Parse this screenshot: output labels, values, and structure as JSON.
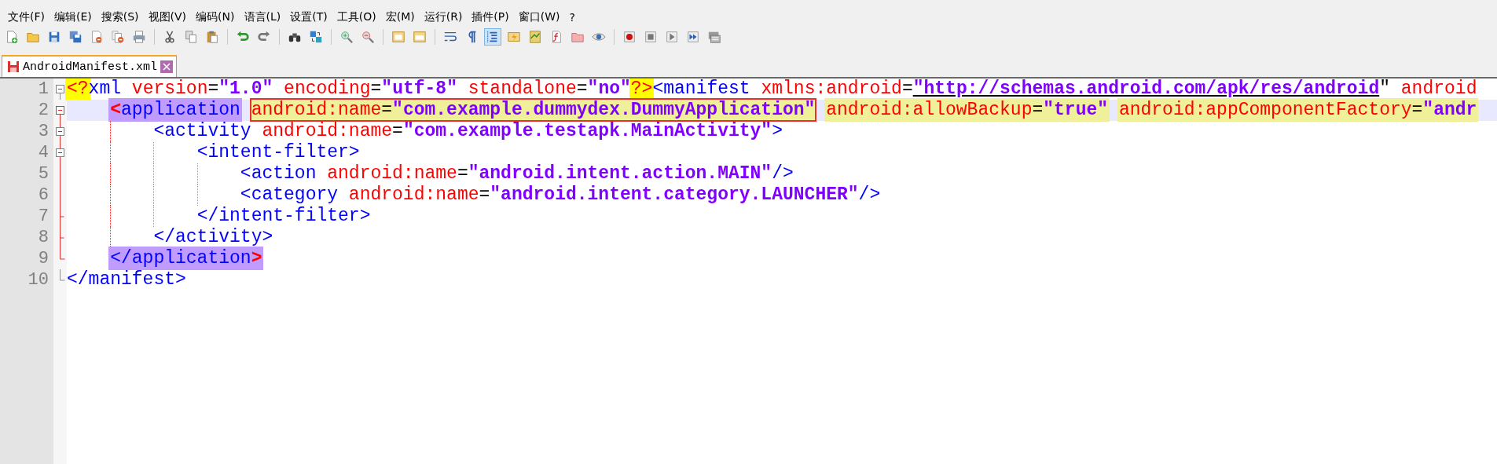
{
  "menu": [
    {
      "label": "文件(F)"
    },
    {
      "label": "编辑(E)"
    },
    {
      "label": "搜索(S)"
    },
    {
      "label": "视图(V)"
    },
    {
      "label": "编码(N)"
    },
    {
      "label": "语言(L)"
    },
    {
      "label": "设置(T)"
    },
    {
      "label": "工具(O)"
    },
    {
      "label": "宏(M)"
    },
    {
      "label": "运行(R)"
    },
    {
      "label": "插件(P)"
    },
    {
      "label": "窗口(W)"
    },
    {
      "label": "?"
    }
  ],
  "toolbar": [
    {
      "kind": "button",
      "pressed": false
    },
    {
      "kind": "button",
      "pressed": false
    },
    {
      "kind": "button",
      "pressed": false
    },
    {
      "kind": "button",
      "pressed": false
    },
    {
      "kind": "button",
      "pressed": false
    },
    {
      "kind": "button",
      "pressed": false
    },
    {
      "kind": "button",
      "pressed": false
    },
    {
      "kind": "separator"
    },
    {
      "kind": "button",
      "pressed": false
    },
    {
      "kind": "button",
      "pressed": false
    },
    {
      "kind": "button",
      "pressed": false
    },
    {
      "kind": "separator"
    },
    {
      "kind": "button",
      "pressed": false
    },
    {
      "kind": "button",
      "pressed": false
    },
    {
      "kind": "separator"
    },
    {
      "kind": "button",
      "pressed": false
    },
    {
      "kind": "button",
      "pressed": false
    },
    {
      "kind": "separator"
    },
    {
      "kind": "button",
      "pressed": false
    },
    {
      "kind": "button",
      "pressed": false
    },
    {
      "kind": "separator"
    },
    {
      "kind": "button",
      "pressed": false
    },
    {
      "kind": "button",
      "pressed": false
    },
    {
      "kind": "separator"
    },
    {
      "kind": "button",
      "pressed": false
    },
    {
      "kind": "button",
      "pressed": false
    },
    {
      "kind": "button",
      "pressed": true
    },
    {
      "kind": "button",
      "pressed": false
    },
    {
      "kind": "button",
      "pressed": false
    },
    {
      "kind": "button",
      "pressed": false
    },
    {
      "kind": "button",
      "pressed": false
    },
    {
      "kind": "button",
      "pressed": false
    },
    {
      "kind": "separator"
    },
    {
      "kind": "button",
      "pressed": false
    },
    {
      "kind": "button",
      "pressed": false
    },
    {
      "kind": "button",
      "pressed": false
    },
    {
      "kind": "button",
      "pressed": false
    },
    {
      "kind": "button",
      "pressed": false
    }
  ],
  "tabs": [
    {
      "label": "AndroidManifest.xml",
      "selected": true
    }
  ],
  "editor": {
    "lines": [
      {
        "number": "1",
        "kind": "fold-start",
        "current": false,
        "fold_active": false,
        "tokens": [
          {
            "kind": "pi",
            "boxed": false,
            "tokens": [
              {
                "kind": "attr",
                "text": "<?"
              }
            ]
          },
          {
            "kind": "tag",
            "text": "xml "
          },
          {
            "kind": "attr",
            "text": "version"
          },
          {
            "kind": "eq",
            "text": "="
          },
          {
            "kind": "value",
            "text": "\"1.0\" "
          },
          {
            "kind": "attr",
            "text": "encoding"
          },
          {
            "kind": "eq",
            "text": "="
          },
          {
            "kind": "value",
            "text": "\"utf-8\" "
          },
          {
            "kind": "attr",
            "text": "standalone"
          },
          {
            "kind": "eq",
            "text": "="
          },
          {
            "kind": "value",
            "text": "\"no\""
          },
          {
            "kind": "pi",
            "boxed": false,
            "tokens": [
              {
                "kind": "attr",
                "text": "?>"
              }
            ]
          },
          {
            "kind": "tag",
            "text": "<manifest "
          },
          {
            "kind": "attr",
            "text": "xmlns:android"
          },
          {
            "kind": "eq",
            "text": "="
          },
          {
            "kind": "url",
            "text": "\"http://schemas.android.com/apk/res/android"
          },
          {
            "kind": "eq",
            "text": "\" "
          },
          {
            "kind": "attr",
            "text": "android"
          }
        ],
        "children": [
          {
            "number": "2",
            "kind": "block-start",
            "current": true,
            "fold_active": true,
            "tokens": [
              {
                "kind": "match",
                "boxed": false,
                "tokens": [
                  {
                    "kind": "bracket",
                    "text": "<"
                  },
                  {
                    "kind": "tag",
                    "text": "application"
                  }
                ]
              },
              {
                "kind": "smart",
                "boxed": true,
                "tokens": [
                  {
                    "kind": "attr",
                    "text": "android:name"
                  },
                  {
                    "kind": "eq",
                    "text": "="
                  },
                  {
                    "kind": "value",
                    "text": "\"com.example.dummydex.DummyApplication\""
                  }
                ]
              },
              {
                "kind": "smart",
                "boxed": false,
                "tokens": [
                  {
                    "kind": "attr",
                    "text": "android:allowBackup"
                  },
                  {
                    "kind": "eq",
                    "text": "="
                  },
                  {
                    "kind": "value",
                    "text": "\"true\""
                  }
                ]
              },
              {
                "kind": "smart",
                "boxed": false,
                "tokens": [
                  {
                    "kind": "attr",
                    "text": "android:appComponentFactory"
                  },
                  {
                    "kind": "eq",
                    "text": "="
                  },
                  {
                    "kind": "value",
                    "text": "\"andr"
                  }
                ]
              }
            ],
            "children": [
              {
                "number": "3",
                "kind": "fold-start",
                "current": false,
                "fold_active": true,
                "tokens": [
                  {
                    "kind": "tag",
                    "text": "<activity "
                  },
                  {
                    "kind": "attr",
                    "text": "android:name"
                  },
                  {
                    "kind": "eq",
                    "text": "="
                  },
                  {
                    "kind": "value",
                    "text": "\"com.example.testapk.MainActivity\""
                  },
                  {
                    "kind": "tag",
                    "text": ">"
                  }
                ],
                "children": [
                  {
                    "number": "4",
                    "kind": "fold-start",
                    "current": false,
                    "fold_active": true,
                    "tokens": [
                      {
                        "kind": "tag",
                        "text": "<intent-filter>"
                      }
                    ],
                    "children": [
                      {
                        "number": "5",
                        "kind": "body",
                        "current": false,
                        "fold_active": true,
                        "tokens": [
                          {
                            "kind": "tag",
                            "text": "<action "
                          },
                          {
                            "kind": "attr",
                            "text": "android:name"
                          },
                          {
                            "kind": "eq",
                            "text": "="
                          },
                          {
                            "kind": "value",
                            "text": "\"android.intent.action.MAIN\""
                          },
                          {
                            "kind": "tag",
                            "text": "/>"
                          }
                        ]
                      },
                      {
                        "number": "6",
                        "kind": "body",
                        "current": false,
                        "fold_active": true,
                        "tokens": [
                          {
                            "kind": "tag",
                            "text": "<category "
                          },
                          {
                            "kind": "attr",
                            "text": "android:name"
                          },
                          {
                            "kind": "eq",
                            "text": "="
                          },
                          {
                            "kind": "value",
                            "text": "\"android.intent.category.LAUNCHER\""
                          },
                          {
                            "kind": "tag",
                            "text": "/>"
                          }
                        ]
                      }
                    ]
                  },
                  {
                    "number": "7",
                    "kind": "inner-end",
                    "current": false,
                    "fold_active": true,
                    "tokens": [
                      {
                        "kind": "tag",
                        "text": "</intent-filter>"
                      }
                    ]
                  }
                ]
              },
              {
                "number": "8",
                "kind": "inner-end",
                "current": false,
                "fold_active": true,
                "tokens": [
                  {
                    "kind": "tag",
                    "text": "</activity>"
                  }
                ]
              }
            ]
          },
          {
            "number": "9",
            "kind": "end",
            "current": false,
            "fold_active": true,
            "tokens": [
              {
                "kind": "match",
                "boxed": false,
                "tokens": [
                  {
                    "kind": "tag",
                    "text": "</application"
                  },
                  {
                    "kind": "bracket",
                    "text": ">"
                  }
                ]
              }
            ]
          }
        ]
      },
      {
        "number": "10",
        "kind": "end",
        "current": false,
        "fold_active": false,
        "tokens": [
          {
            "kind": "tag",
            "text": "</manifest>"
          }
        ]
      }
    ]
  }
}
